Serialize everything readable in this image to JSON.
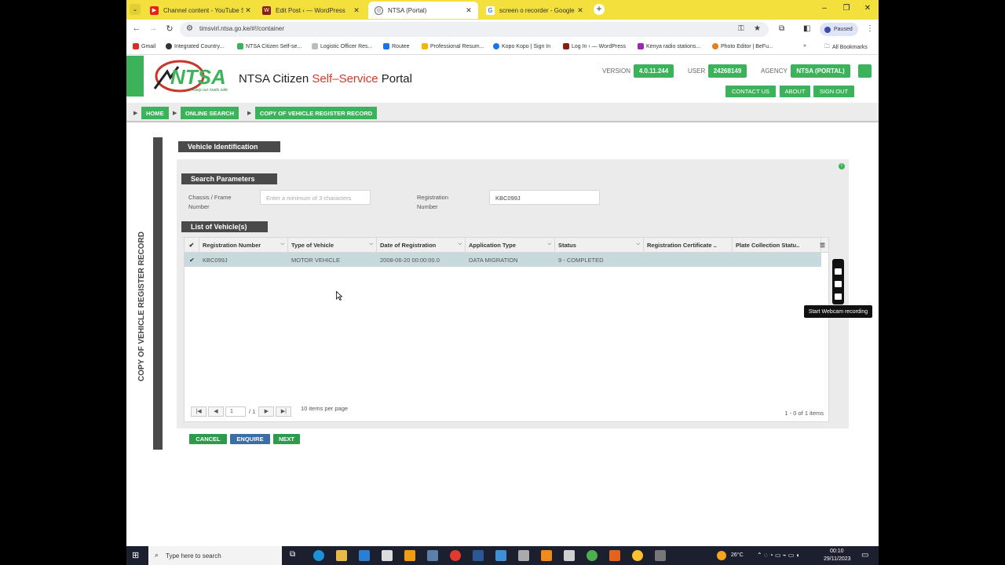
{
  "browser": {
    "tabs": [
      {
        "title": "Channel content - YouTube Stu",
        "color": "#e62117"
      },
      {
        "title": "Edit Post ‹ — WordPress",
        "color": "#8a1f11"
      },
      {
        "title": "NTSA (Portal)",
        "color": "#555555"
      },
      {
        "title": "screen o recorder - Google Sea",
        "color": "#4285f4"
      }
    ],
    "url": "timsvirl.ntsa.go.ke/#!/container",
    "profile_status": "Paused",
    "bookmarks": [
      {
        "label": "Gmail",
        "color": "#d93025"
      },
      {
        "label": "Integrated Country...",
        "color": "#333333"
      },
      {
        "label": "NTSA Citizen Self-se...",
        "color": "#3cb35b"
      },
      {
        "label": "Logistic Officer Res...",
        "color": "#888888"
      },
      {
        "label": "Routee",
        "color": "#1a73e8"
      },
      {
        "label": "Professional Resum...",
        "color": "#f2b705"
      },
      {
        "label": "Kopo Kopo | Sign In",
        "color": "#1a73e8"
      },
      {
        "label": "Log In ‹ — WordPress",
        "color": "#8a1f11"
      },
      {
        "label": "Kenya radio stations...",
        "color": "#9c27b0"
      },
      {
        "label": "Photo Editor | BeFu...",
        "color": "#e67e22"
      }
    ],
    "all_bookmarks": "All Bookmarks"
  },
  "portal": {
    "logo_text": "NTSA",
    "logo_tagline": "Keep our roads safe",
    "title_a": "NTSA Citizen ",
    "title_b": "Self–Service",
    "title_c": " Portal",
    "version_label": "VERSION",
    "version_value": "4.0.11.244",
    "user_label": "USER",
    "user_value": "24268149",
    "agency_label": "AGENCY",
    "agency_value": "NTSA (PORTAL)",
    "nav": [
      "CONTACT US",
      "ABOUT",
      "SIGN OUT"
    ],
    "breadcrumb": [
      "HOME",
      "ONLINE SEARCH",
      "COPY OF VEHICLE REGISTER RECORD"
    ],
    "brand_green": "#3cb35b"
  },
  "main": {
    "side_title": "COPY OF VEHICLE REGISTER RECORD",
    "section_title": "Vehicle Identification",
    "search_title": "Search Parameters",
    "chassis_label": "Chassis / Frame Number",
    "chassis_placeholder": "Enter a minimum of 3 characters",
    "reg_label": "Registration Number",
    "reg_value": "KBC099J",
    "list_title": "List of Vehicle(s)",
    "columns": [
      "Registration Number",
      "Type of Vehicle",
      "Date of Registration",
      "Application Type",
      "Status",
      "Registration Certificate ..",
      "Plate Collection Statu.."
    ],
    "rows": [
      [
        "KBC099J",
        "MOTOR VEHICLE",
        "2008-06-20 00:00:00.0",
        "DATA MIGRATION",
        "9 - COMPLETED",
        "",
        ""
      ]
    ],
    "page_value": "1",
    "page_total": "/ 1",
    "items_per_page": "10 items per page",
    "items_count": "1 - 0 of 1 items",
    "buttons": [
      "CANCEL",
      "ENQUIRE",
      "NEXT"
    ]
  },
  "recorder": {
    "tooltip": "Start Webcam recording"
  },
  "taskbar": {
    "search_placeholder": "Type here to search",
    "temperature": "26°C",
    "time": "00:10",
    "date": "29/11/2023"
  }
}
